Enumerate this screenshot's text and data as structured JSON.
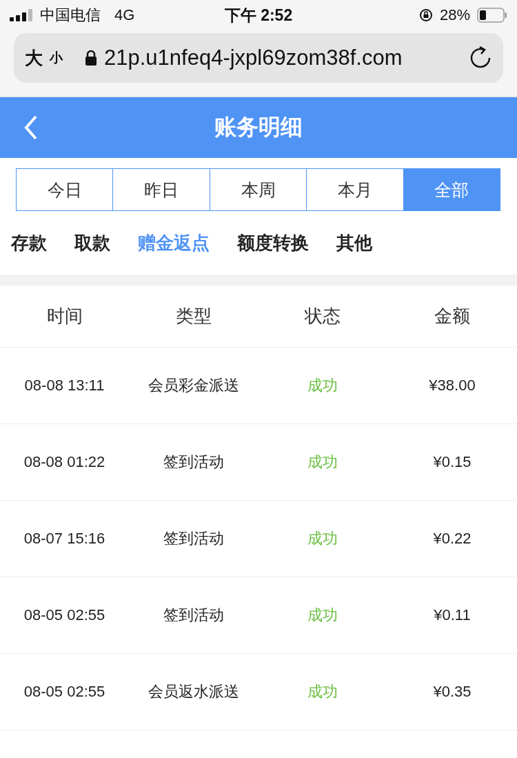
{
  "status_bar": {
    "carrier": "中国电信",
    "network": "4G",
    "time": "下午 2:52",
    "battery": "28%"
  },
  "browser": {
    "text_size_large": "大",
    "text_size_small": "小",
    "url": "21p.u1nfeq4-jxpl69zom38f.com"
  },
  "header": {
    "title": "账务明细"
  },
  "period_tabs": [
    {
      "label": "今日",
      "selected": false
    },
    {
      "label": "昨日",
      "selected": false
    },
    {
      "label": "本周",
      "selected": false
    },
    {
      "label": "本月",
      "selected": false
    },
    {
      "label": "全部",
      "selected": true
    }
  ],
  "category_tabs": [
    {
      "label": "存款",
      "selected": false
    },
    {
      "label": "取款",
      "selected": false
    },
    {
      "label": "赠金返点",
      "selected": true
    },
    {
      "label": "额度转换",
      "selected": false
    },
    {
      "label": "其他",
      "selected": false
    }
  ],
  "table": {
    "columns": [
      "时间",
      "类型",
      "状态",
      "金额"
    ],
    "rows": [
      {
        "time": "08-08 13:11",
        "type": "会员彩金派送",
        "status": "成功",
        "amount": "¥38.00"
      },
      {
        "time": "08-08 01:22",
        "type": "签到活动",
        "status": "成功",
        "amount": "¥0.15"
      },
      {
        "time": "08-07 15:16",
        "type": "签到活动",
        "status": "成功",
        "amount": "¥0.22"
      },
      {
        "time": "08-05 02:55",
        "type": "签到活动",
        "status": "成功",
        "amount": "¥0.11"
      },
      {
        "time": "08-05 02:55",
        "type": "会员返水派送",
        "status": "成功",
        "amount": "¥0.35"
      }
    ]
  }
}
